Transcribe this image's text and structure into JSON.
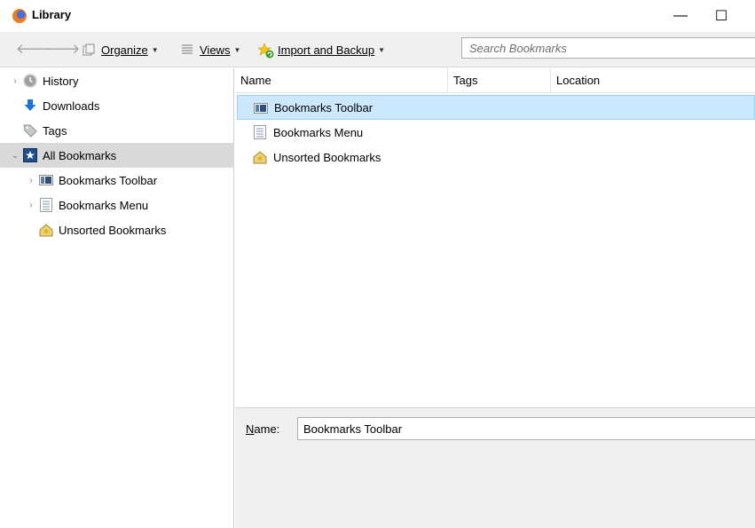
{
  "window": {
    "title": "Library",
    "controls": {
      "minimize": "—",
      "maximize": "☐",
      "close": "✕"
    }
  },
  "toolbar": {
    "back_glyph": "🡐",
    "forward_glyph": "🡒",
    "organize_label": "Organize",
    "views_label": "Views",
    "import_label": "Import and Backup",
    "search_placeholder": "Search Bookmarks"
  },
  "tree": {
    "items": [
      {
        "label": "History",
        "icon": "history-icon",
        "expandable": true
      },
      {
        "label": "Downloads",
        "icon": "download-icon",
        "expandable": false
      },
      {
        "label": "Tags",
        "icon": "tag-icon",
        "expandable": false
      },
      {
        "label": "All Bookmarks",
        "icon": "all-bookmarks-icon",
        "expandable": true,
        "expanded": true,
        "selected": true
      },
      {
        "label": "Bookmarks Toolbar",
        "icon": "bookmarks-toolbar-icon",
        "expandable": true
      },
      {
        "label": "Bookmarks Menu",
        "icon": "bookmarks-menu-icon",
        "expandable": true
      },
      {
        "label": "Unsorted Bookmarks",
        "icon": "unsorted-bookmarks-icon",
        "expandable": false
      }
    ]
  },
  "list": {
    "columns": {
      "name": "Name",
      "tags": "Tags",
      "location": "Location"
    },
    "rows": [
      {
        "name": "Bookmarks Toolbar",
        "icon": "bookmarks-toolbar-icon",
        "selected": true
      },
      {
        "name": "Bookmarks Menu",
        "icon": "bookmarks-menu-icon"
      },
      {
        "name": "Unsorted Bookmarks",
        "icon": "unsorted-bookmarks-icon"
      }
    ]
  },
  "details": {
    "name_label_accel": "N",
    "name_label_rest": "ame:",
    "name_value": "Bookmarks Toolbar"
  },
  "colors": {
    "toolbar_bg": "#f0f0f0",
    "tree_selected": "#d9d9d9",
    "list_selected": "#cce8ff",
    "list_selected_border": "#99d1ff"
  }
}
